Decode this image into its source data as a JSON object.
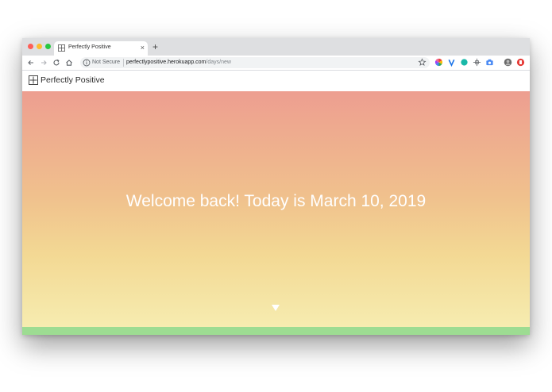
{
  "browser": {
    "tab_title": "Perfectly Positive",
    "tab_close": "×",
    "new_tab": "+",
    "security_label": "Not Secure",
    "url_host": "perfectlypositive.herokuapp.com",
    "url_path": "/days/new",
    "icons": [
      "back-icon",
      "forward-icon",
      "reload-icon",
      "home-icon",
      "info-icon",
      "star-icon"
    ],
    "extensions": [
      "color-wheel-extension-icon",
      "v-extension-icon",
      "teal-circle-extension-icon",
      "crosshair-extension-icon",
      "camera-extension-icon",
      "profile-avatar-icon",
      "red-extension-icon"
    ]
  },
  "site": {
    "name": "Perfectly Positive",
    "logo_icon": "plus-box-icon"
  },
  "hero": {
    "welcome_text": "Welcome back! Today is March 10, 2019",
    "scroll_icon": "down-triangle-icon",
    "gradient_top": "#ed9e90",
    "gradient_bottom": "#f6ecb0",
    "footer_strip_color": "#9ddc92"
  }
}
